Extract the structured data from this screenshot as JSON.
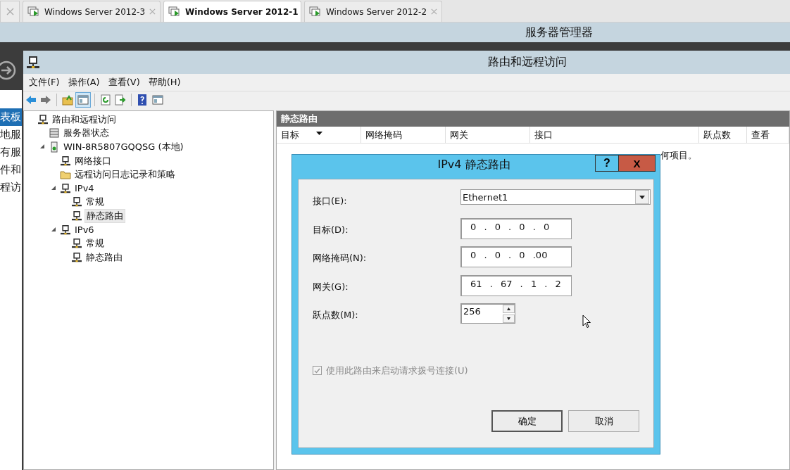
{
  "browser_tabs": [
    {
      "label": "Windows Server 2012-3",
      "selected": false
    },
    {
      "label": "Windows Server 2012-1",
      "selected": true
    },
    {
      "label": "Windows Server 2012-2",
      "selected": false
    }
  ],
  "server_manager": {
    "title": "服务器管理器",
    "sidebar_items": [
      {
        "label": "表板",
        "selected": true
      },
      {
        "label": "地服",
        "selected": false
      },
      {
        "label": "有服",
        "selected": false
      },
      {
        "label": "件和",
        "selected": false
      },
      {
        "label": "程访",
        "selected": false
      }
    ]
  },
  "window": {
    "title": "路由和远程访问",
    "menu": [
      "文件(F)",
      "操作(A)",
      "查看(V)",
      "帮助(H)"
    ],
    "toolbar": [
      {
        "kind": "back"
      },
      {
        "kind": "forward"
      },
      {
        "kind": "sep"
      },
      {
        "kind": "folder-up"
      },
      {
        "kind": "pane",
        "selected": true
      },
      {
        "kind": "sep"
      },
      {
        "kind": "refresh"
      },
      {
        "kind": "export"
      },
      {
        "kind": "sep"
      },
      {
        "kind": "help"
      },
      {
        "kind": "pane2"
      }
    ],
    "tree": [
      {
        "label": "路由和远程访问",
        "kind": "network",
        "selected": false,
        "children": [
          {
            "label": "服务器状态",
            "kind": "server",
            "selected": false
          },
          {
            "label": "WIN-8R5807GQQSG (本地)",
            "kind": "computer",
            "expanded": true,
            "selected": false,
            "children": [
              {
                "label": "网络接口",
                "kind": "network",
                "selected": false
              },
              {
                "label": "远程访问日志记录和策略",
                "kind": "folder",
                "selected": false
              },
              {
                "label": "IPv4",
                "kind": "network",
                "expanded": true,
                "selected": false,
                "children": [
                  {
                    "label": "常规",
                    "kind": "network",
                    "selected": false
                  },
                  {
                    "label": "静态路由",
                    "kind": "network",
                    "selected": true
                  }
                ]
              },
              {
                "label": "IPv6",
                "kind": "network",
                "expanded": true,
                "selected": false,
                "children": [
                  {
                    "label": "常规",
                    "kind": "network",
                    "selected": false
                  },
                  {
                    "label": "静态路由",
                    "kind": "network",
                    "selected": false
                  }
                ]
              }
            ]
          }
        ]
      }
    ],
    "panel": {
      "title": "静态路由",
      "columns": [
        {
          "label": "目标",
          "sorted": true
        },
        {
          "label": "网络掩码",
          "sorted": false
        },
        {
          "label": "网关",
          "sorted": false
        },
        {
          "label": "接口",
          "sorted": false
        },
        {
          "label": "跃点数",
          "sorted": false
        },
        {
          "label": "查看",
          "sorted": false
        }
      ],
      "empty_message": "何项目。"
    }
  },
  "dialog": {
    "title": "IPv4 静态路由",
    "help": "?",
    "close": "X",
    "fields": [
      {
        "kind": "dropdown",
        "label": "接口(E):",
        "value": "Ethernet1"
      },
      {
        "kind": "ip",
        "label": "目标(D):",
        "value": "0 . 0 . 0 . 0"
      },
      {
        "kind": "ip",
        "label": "网络掩码(N):",
        "value": "0 . 0 . 0 .00"
      },
      {
        "kind": "ip",
        "label": "网关(G):",
        "value": "61 . 67 . 1 . 2"
      },
      {
        "kind": "spin",
        "label": "跃点数(M):",
        "value": "256"
      }
    ],
    "checkbox": {
      "label": "使用此路由来启动请求拨号连接(U)",
      "checked": true,
      "disabled": true
    },
    "buttons": [
      {
        "label": "确定",
        "default": true
      },
      {
        "label": "取消",
        "default": false
      }
    ]
  }
}
